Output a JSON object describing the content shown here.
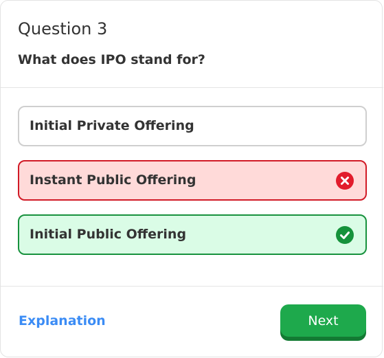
{
  "question": {
    "number_label": "Question 3",
    "text": "What does IPO stand for?"
  },
  "options": [
    {
      "label": "Initial Private Offering",
      "state": "neutral"
    },
    {
      "label": "Instant Public Offering",
      "state": "wrong",
      "icon": "x-circle-icon"
    },
    {
      "label": "Initial Public Offering",
      "state": "correct",
      "icon": "check-circle-icon"
    }
  ],
  "footer": {
    "explanation_label": "Explanation",
    "next_label": "Next"
  },
  "colors": {
    "wrong_border": "#d11a26",
    "wrong_bg": "#ffdad9",
    "correct_border": "#17913d",
    "correct_bg": "#dafce6",
    "link": "#3b8cf5",
    "next_button": "#1ea94c"
  }
}
